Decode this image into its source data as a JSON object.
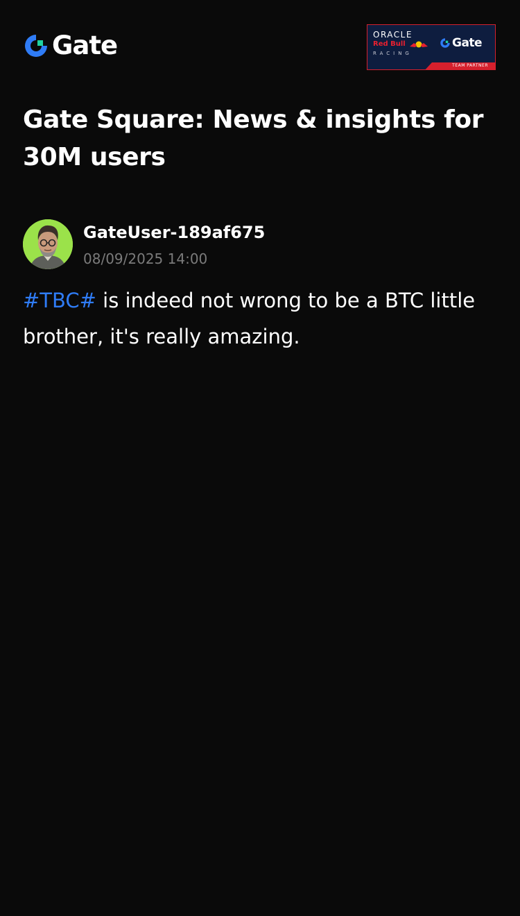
{
  "header": {
    "logo_text": "Gate",
    "partner_badge": {
      "oracle": "ORACLE",
      "redbull": "Red Bull",
      "racing": "RACING",
      "gate": "Gate",
      "strip": "TEAM PARTNER"
    }
  },
  "page_title": "Gate Square: News & insights for 30M users",
  "post": {
    "author": "GateUser-189af675",
    "timestamp": "08/09/2025 14:00",
    "hashtag": "#TBC#",
    "text": " is indeed not wrong to be a BTC little brother, it's really amazing."
  },
  "colors": {
    "background": "#0a0a0a",
    "brand_blue": "#2f7cf6",
    "brand_green": "#1fd2a1",
    "muted_text": "#7b7b7b",
    "badge_navy": "#0e1d3f",
    "badge_red": "#d6202d"
  },
  "icons": {
    "logo": "gate-logo-icon",
    "avatar": "user-avatar-portrait"
  }
}
